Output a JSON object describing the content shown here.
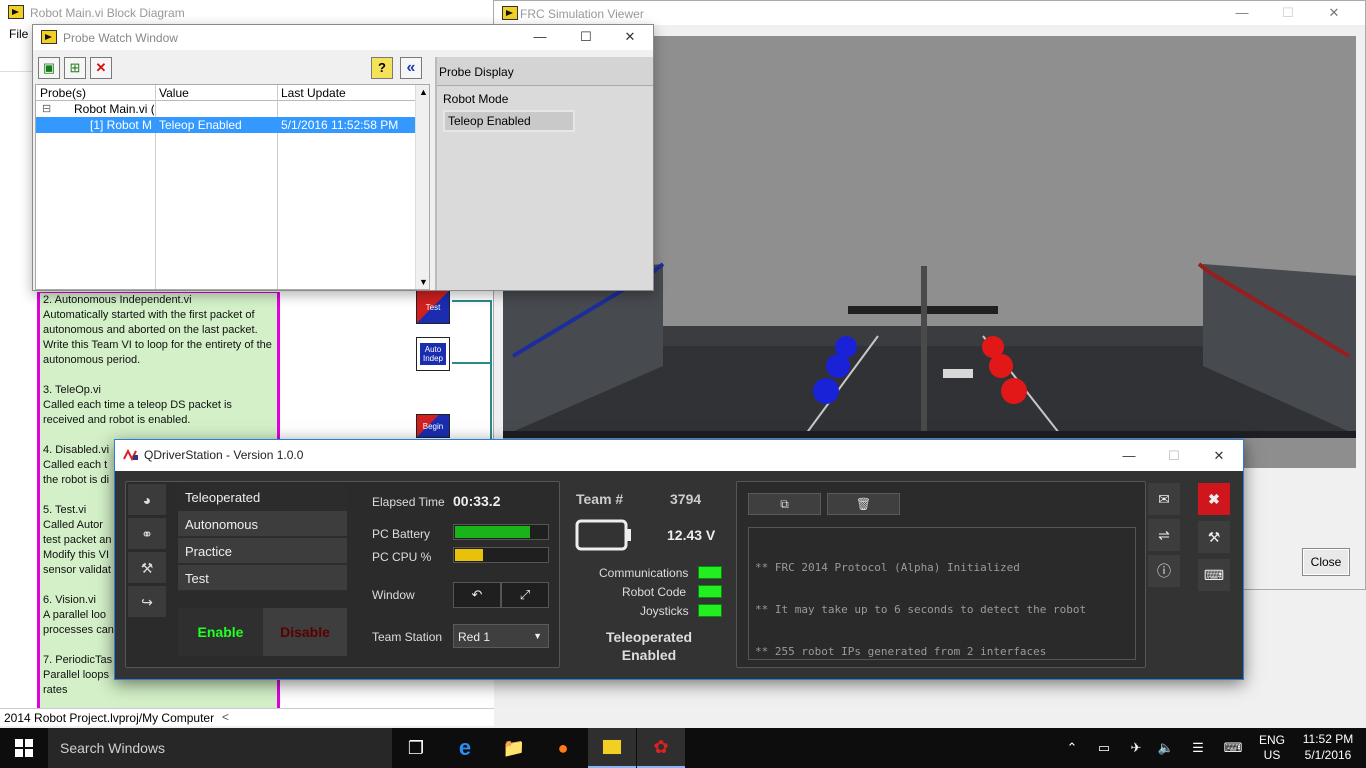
{
  "block_diagram": {
    "title": "Robot Main.vi Block Diagram",
    "menu_file": "File",
    "comment_paragraphs": [
      "2. Autonomous Independent.vi\n  Automatically started with the first packet of autonomous and aborted on the last packet. Write this Team VI to loop for the entirety of the autonomous period.",
      "3. TeleOp.vi\n  Called each time a teleop DS packet is received and robot is enabled.",
      "4. Disabled.vi\n  Called each t\nthe robot is di",
      "5. Test.vi\n  Called Autor\ntest packet an\nModify this VI\nsensor validat",
      "6. Vision.vi\n  A parallel loo\nprocesses can",
      "7. PeriodicTas\n  Parallel loops\nrates"
    ],
    "vi_icons": [
      "Test",
      "Auto Indep",
      "Begin"
    ],
    "status_path": "2014 Robot Project.lvproj/My Computer",
    "status_scroll": "<"
  },
  "sim_viewer": {
    "title": "FRC Simulation Viewer",
    "close_button": "Close"
  },
  "probe_window": {
    "title": "Probe Watch Window",
    "tools": [
      "new-probe",
      "add-probe",
      "delete-probe",
      "help",
      "collapse"
    ],
    "help_glyph": "?",
    "collapse_glyph": "«",
    "delete_glyph": "✕",
    "columns": [
      "Probe(s)",
      "Value",
      "Last Update"
    ],
    "tree_root": "Robot Main.vi (",
    "tree_root_toggle": "⊟",
    "row": {
      "probe": "[1] Robot M",
      "value": "Teleop Enabled",
      "last_update": "5/1/2016 11:52:58 PM"
    },
    "display_label": "Probe Display",
    "robot_mode_label": "Robot Mode",
    "robot_mode_value": "Teleop Enabled"
  },
  "driver_station": {
    "title": "QDriverStation - Version 1.0.0",
    "modes": [
      "Teleoperated",
      "Autonomous",
      "Practice",
      "Test"
    ],
    "selected_mode": "Teleoperated",
    "enable_label": "Enable",
    "disable_label": "Disable",
    "elapsed_label": "Elapsed Time",
    "elapsed_value": "00:33.2",
    "pc_battery_label": "PC Battery",
    "pc_battery_level": 0.8,
    "pc_cpu_label": "PC CPU %",
    "pc_cpu_level": 0.3,
    "window_label": "Window",
    "team_station_label": "Team Station",
    "team_station_value": "Red 1",
    "team_label": "Team #",
    "team_number": "3794",
    "voltage": "12.43 V",
    "indicators": [
      "Communications",
      "Robot Code",
      "Joysticks"
    ],
    "status_text": "Teleoperated\nEnabled",
    "console_lines": [
      "** FRC 2014 Protocol (Alpha) Initialized",
      "** It may take up to 6 seconds to detect the robot",
      "** 255 robot IPs generated from 2 interfaces"
    ],
    "colors": {
      "enable": "#22ff22",
      "disable": "#5a0000",
      "battery": "#19b31a",
      "cpu": "#e8c20a",
      "close": "#d0161d"
    }
  },
  "taskbar": {
    "search_placeholder": "Search Windows",
    "lang_primary": "ENG",
    "lang_secondary": "US",
    "time": "11:52 PM",
    "date": "5/1/2016"
  }
}
